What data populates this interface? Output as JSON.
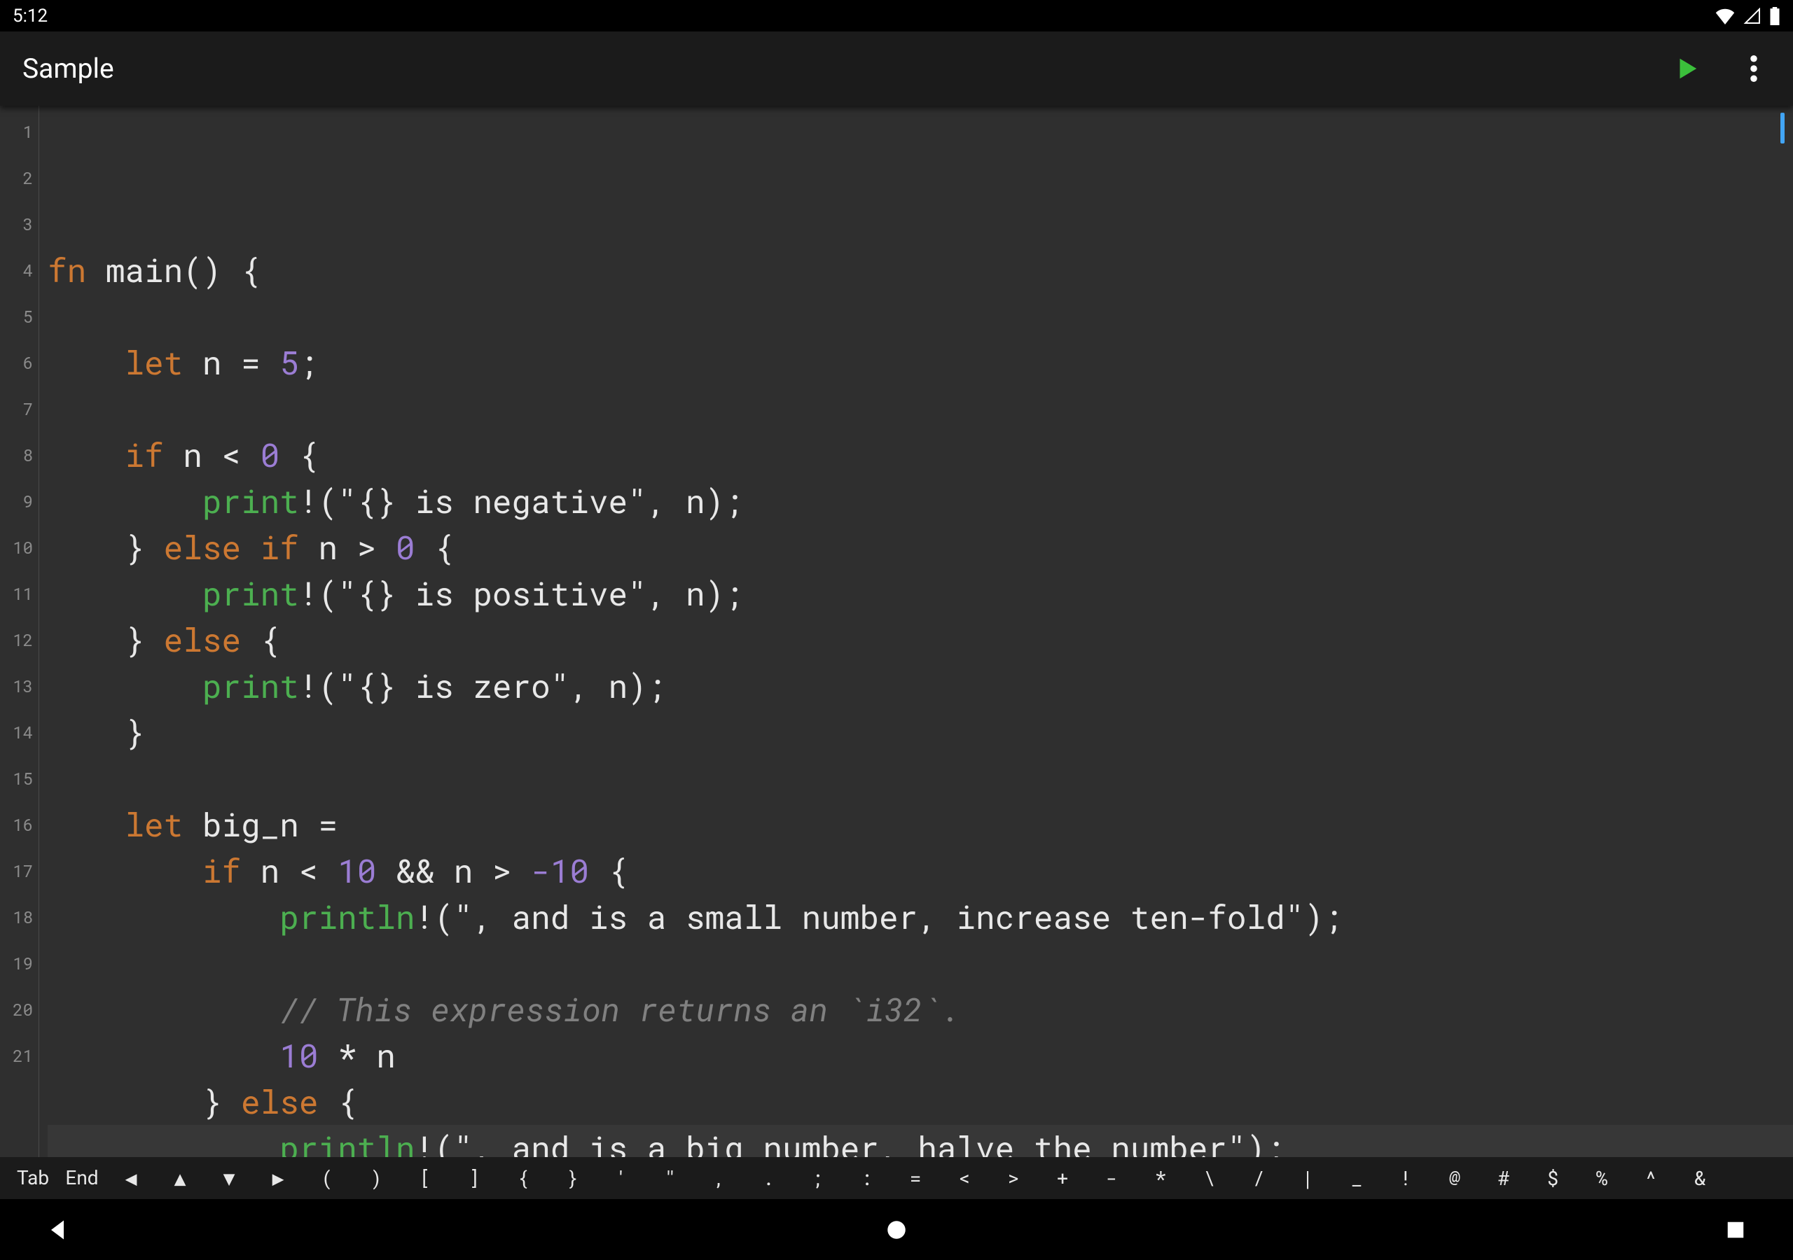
{
  "status": {
    "time": "5:12"
  },
  "appbar": {
    "title": "Sample"
  },
  "code": {
    "lines": [
      [
        {
          "t": "fn",
          "c": "tok-kw"
        },
        {
          "t": " main() {",
          "c": "tok-punc"
        }
      ],
      [],
      [
        {
          "t": "    ",
          "c": ""
        },
        {
          "t": "let",
          "c": "tok-kw"
        },
        {
          "t": " n = ",
          "c": "tok-punc"
        },
        {
          "t": "5",
          "c": "tok-num"
        },
        {
          "t": ";",
          "c": "tok-punc"
        }
      ],
      [],
      [
        {
          "t": "    ",
          "c": ""
        },
        {
          "t": "if",
          "c": "tok-kw"
        },
        {
          "t": " n < ",
          "c": "tok-punc"
        },
        {
          "t": "0",
          "c": "tok-num"
        },
        {
          "t": " {",
          "c": "tok-punc"
        }
      ],
      [
        {
          "t": "        ",
          "c": ""
        },
        {
          "t": "print",
          "c": "tok-fn"
        },
        {
          "t": "!(",
          "c": "tok-punc"
        },
        {
          "t": "\"{} is negative\"",
          "c": "tok-str"
        },
        {
          "t": ", n);",
          "c": "tok-punc"
        }
      ],
      [
        {
          "t": "    } ",
          "c": "tok-punc"
        },
        {
          "t": "else",
          "c": "tok-kw"
        },
        {
          "t": " ",
          "c": ""
        },
        {
          "t": "if",
          "c": "tok-kw"
        },
        {
          "t": " n > ",
          "c": "tok-punc"
        },
        {
          "t": "0",
          "c": "tok-num"
        },
        {
          "t": " {",
          "c": "tok-punc"
        }
      ],
      [
        {
          "t": "        ",
          "c": ""
        },
        {
          "t": "print",
          "c": "tok-fn"
        },
        {
          "t": "!(",
          "c": "tok-punc"
        },
        {
          "t": "\"{} is positive\"",
          "c": "tok-str"
        },
        {
          "t": ", n);",
          "c": "tok-punc"
        }
      ],
      [
        {
          "t": "    } ",
          "c": "tok-punc"
        },
        {
          "t": "else",
          "c": "tok-kw"
        },
        {
          "t": " {",
          "c": "tok-punc"
        }
      ],
      [
        {
          "t": "        ",
          "c": ""
        },
        {
          "t": "print",
          "c": "tok-fn"
        },
        {
          "t": "!(",
          "c": "tok-punc"
        },
        {
          "t": "\"{} is zero\"",
          "c": "tok-str"
        },
        {
          "t": ", n);",
          "c": "tok-punc"
        }
      ],
      [
        {
          "t": "    }",
          "c": "tok-punc"
        }
      ],
      [],
      [
        {
          "t": "    ",
          "c": ""
        },
        {
          "t": "let",
          "c": "tok-kw"
        },
        {
          "t": " big_n =",
          "c": "tok-punc"
        }
      ],
      [
        {
          "t": "        ",
          "c": ""
        },
        {
          "t": "if",
          "c": "tok-kw"
        },
        {
          "t": " n < ",
          "c": "tok-punc"
        },
        {
          "t": "10",
          "c": "tok-num"
        },
        {
          "t": " && n > ",
          "c": "tok-punc"
        },
        {
          "t": "-10",
          "c": "tok-num"
        },
        {
          "t": " {",
          "c": "tok-punc"
        }
      ],
      [
        {
          "t": "            ",
          "c": ""
        },
        {
          "t": "println",
          "c": "tok-fn"
        },
        {
          "t": "!(",
          "c": "tok-punc"
        },
        {
          "t": "\", and is a small number, increase ten-fold\"",
          "c": "tok-str"
        },
        {
          "t": ");",
          "c": "tok-punc"
        }
      ],
      [],
      [
        {
          "t": "            ",
          "c": ""
        },
        {
          "t": "// This expression returns an `i32`.",
          "c": "tok-comment"
        }
      ],
      [
        {
          "t": "            ",
          "c": ""
        },
        {
          "t": "10",
          "c": "tok-num"
        },
        {
          "t": " * n",
          "c": "tok-punc"
        }
      ],
      [
        {
          "t": "        } ",
          "c": "tok-punc"
        },
        {
          "t": "else",
          "c": "tok-kw"
        },
        {
          "t": " {",
          "c": "tok-punc"
        }
      ],
      [
        {
          "t": "            ",
          "c": ""
        },
        {
          "t": "println",
          "c": "tok-fn"
        },
        {
          "t": "!(",
          "c": "tok-punc"
        },
        {
          "t": "\", and is a big number, halve the number\"",
          "c": "tok-str"
        },
        {
          "t": ");",
          "c": "tok-punc"
        }
      ],
      []
    ],
    "highlight_line_index": 19
  },
  "keyrow": {
    "keys": [
      "Tab",
      "End",
      "◀",
      "▲",
      "▼",
      "▶",
      "(",
      ")",
      "[",
      "]",
      "{",
      "}",
      "'",
      "\"",
      ",",
      ".",
      ";",
      ":",
      "=",
      "<",
      ">",
      "+",
      "-",
      "*",
      "\\",
      "/",
      "|",
      "_",
      "!",
      "@",
      "#",
      "$",
      "%",
      "^",
      "&"
    ]
  }
}
